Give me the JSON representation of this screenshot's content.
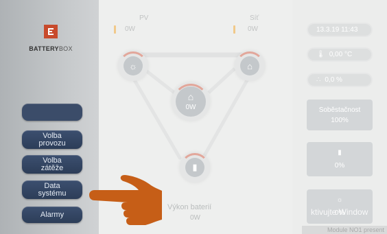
{
  "brand": {
    "name_bold": "BATTERY",
    "name_light": "BOX",
    "color": "#c84a2c"
  },
  "sidebar": {
    "buttons": [
      {
        "label": ""
      },
      {
        "label": "Volba\nprovozu"
      },
      {
        "label": "Volba\nzátěže"
      },
      {
        "label": "Data\nsystému"
      },
      {
        "label": "Alarmy"
      }
    ]
  },
  "flow": {
    "pv_label": "PV",
    "pv_value": "0W",
    "grid_label": "Síť",
    "grid_value": "0W",
    "house_value": "0W",
    "battery_label": "Výkon baterií",
    "battery_value": "0W"
  },
  "status": {
    "datetime": "13.3.19 11:43",
    "temperature": "0,00 °C",
    "humidity": "0,0 %",
    "self_sufficiency_label": "Soběstačnost",
    "self_sufficiency_value": "100%",
    "battery_percent": "0%",
    "pv_percent": "0%"
  },
  "overlay": {
    "watermark": "ktivujte Window",
    "footer": "Module NO1 present"
  },
  "icons": {
    "pv": "sun-panel-icon",
    "grid": "pylon-icon",
    "house": "house-icon",
    "battery": "battery-icon",
    "thermometer": "thermometer-icon",
    "humidity": "droplets-icon",
    "pointer": "pointing-hand-icon"
  },
  "colors": {
    "button": "#34476a",
    "accent_arc": "#e2a79b",
    "hand": "#c65e17"
  }
}
